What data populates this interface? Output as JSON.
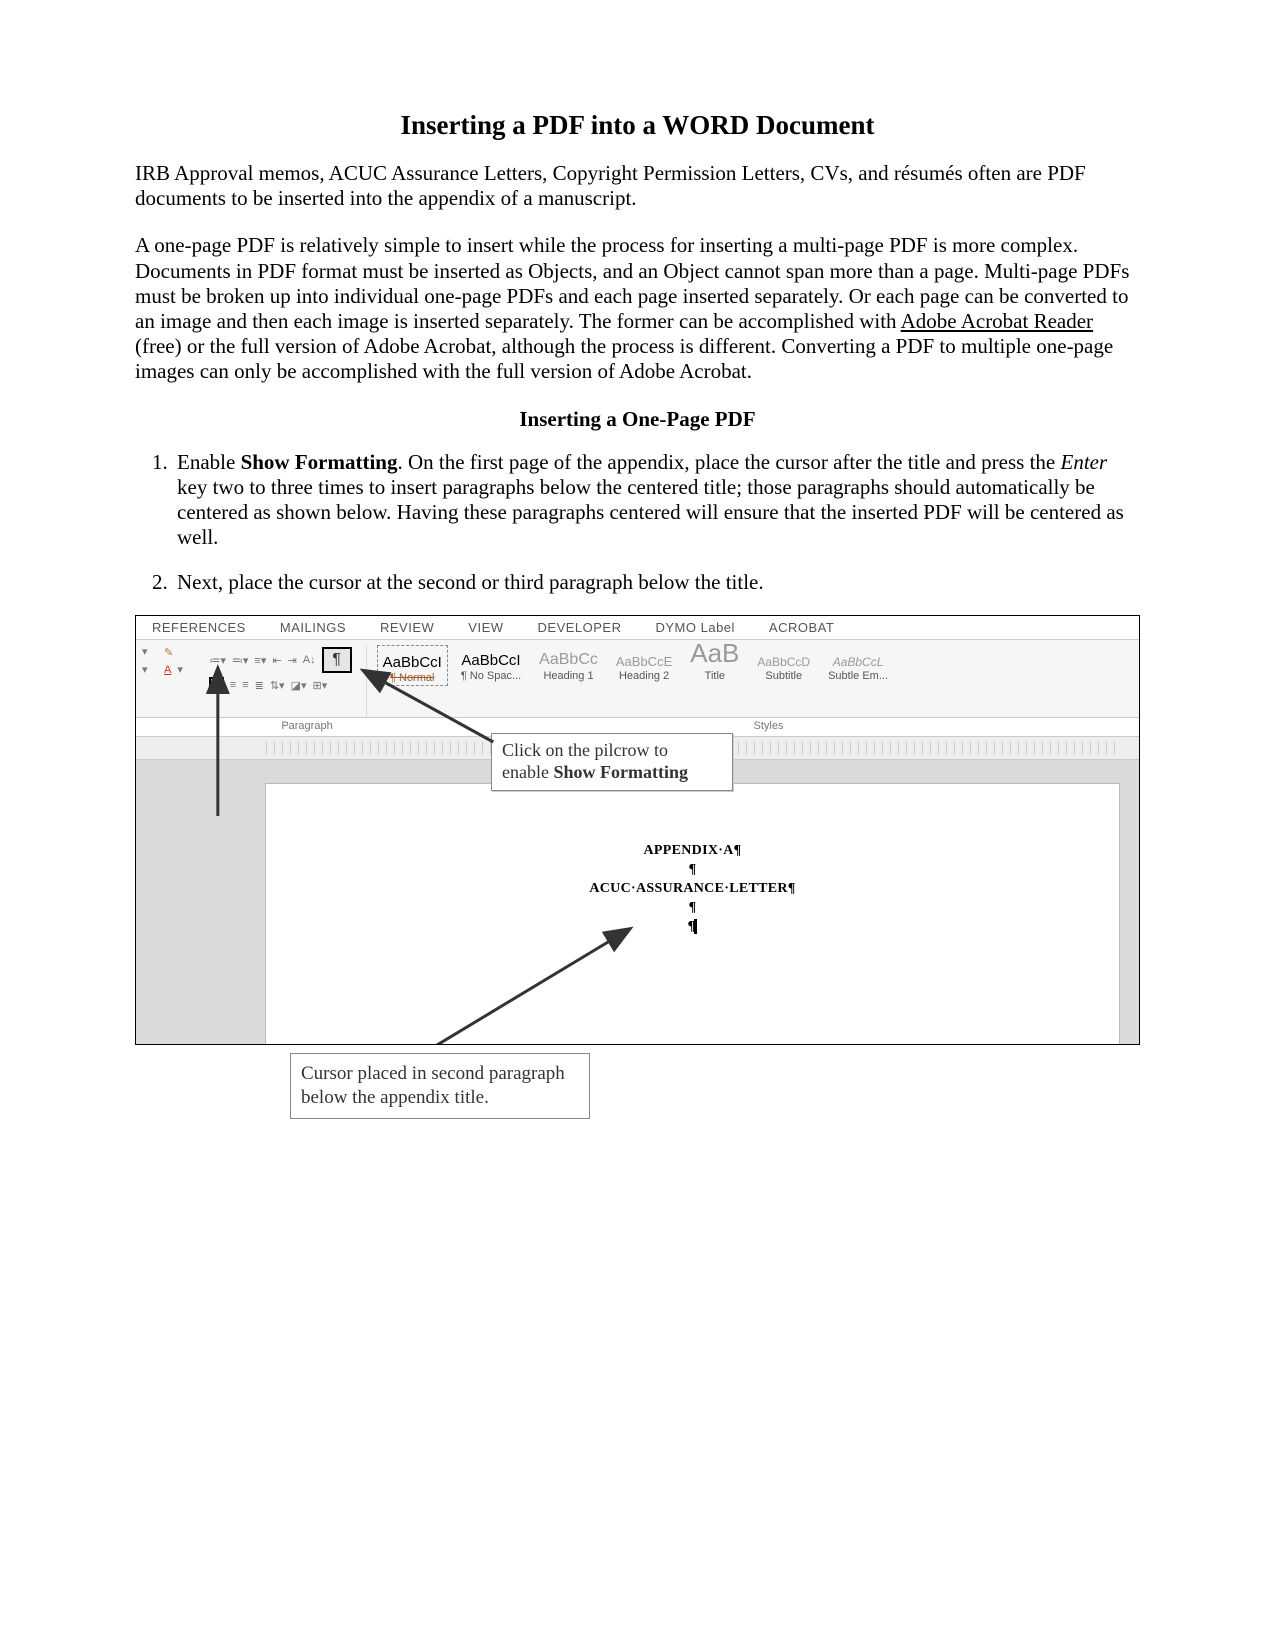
{
  "title": "Inserting a PDF into a WORD Document",
  "para1": "IRB Approval memos, ACUC Assurance Letters, Copyright Permission Letters, CVs, and résumés often are PDF documents to be inserted into the appendix of a manuscript.",
  "para2_pre": "A one-page PDF is relatively simple to insert while the process for inserting a multi-page PDF is more complex. Documents in PDF format must be inserted as Objects, and an Object cannot span more than a page. Multi-page PDFs must be broken up into individual one-page PDFs and each page inserted separately. Or each page can be converted to an image and then each image is inserted separately. The former can be accomplished with ",
  "para2_link": "Adobe Acrobat Reader",
  "para2_post": " (free) or the full version of Adobe Acrobat, although the process is different. Converting a PDF to multiple one-page images can only be accomplished with the full version of Adobe Acrobat.",
  "subheading": "Inserting a One-Page PDF",
  "step1": {
    "lead": "Enable ",
    "bold": "Show Formatting",
    "rest": ". On the first page of the appendix, place the cursor after the title and press the ",
    "italic": "Enter",
    "rest2": " key two to three times to insert paragraphs below the centered title; those paragraphs should automatically be centered as shown below. Having these paragraphs centered will ensure that the inserted PDF will be centered as well."
  },
  "step2": "Next, place the cursor at the second or third paragraph below the title.",
  "word": {
    "tabs": [
      "REFERENCES",
      "MAILINGS",
      "REVIEW",
      "VIEW",
      "DEVELOPER",
      "DYMO Label",
      "ACROBAT"
    ],
    "styles": [
      {
        "preview": "AaBbCcI",
        "label": "¶ Normal",
        "cls": "normal",
        "size": "15px",
        "color": "#000",
        "strike": true
      },
      {
        "preview": "AaBbCcI",
        "label": "¶ No Spac...",
        "size": "15px",
        "color": "#000"
      },
      {
        "preview": "AaBbCc",
        "label": "Heading 1",
        "size": "16px",
        "color": "#9a9a9a"
      },
      {
        "preview": "AaBbCcE",
        "label": "Heading 2",
        "size": "13px",
        "color": "#9a9a9a"
      },
      {
        "preview": "AaB",
        "label": "Title",
        "size": "26px",
        "color": "#9a9a9a",
        "light": true
      },
      {
        "preview": "AaBbCcD",
        "label": "Subtitle",
        "size": "12px",
        "color": "#9a9a9a"
      },
      {
        "preview": "AaBbCcL",
        "label": "Subtle Em...",
        "size": "12px",
        "color": "#9a9a9a",
        "italic": true
      }
    ],
    "group_para": "Paragraph",
    "group_styles": "Styles",
    "appendix_line1": "APPENDIX·A¶",
    "appendix_line2": "ACUC·ASSURANCE·LETTER¶",
    "pilcrow": "¶"
  },
  "callout1_a": "Click on the pilcrow to",
  "callout1_b": "enable ",
  "callout1_bold": "Show Formatting",
  "callout2": "Cursor placed in second paragraph below the appendix title."
}
